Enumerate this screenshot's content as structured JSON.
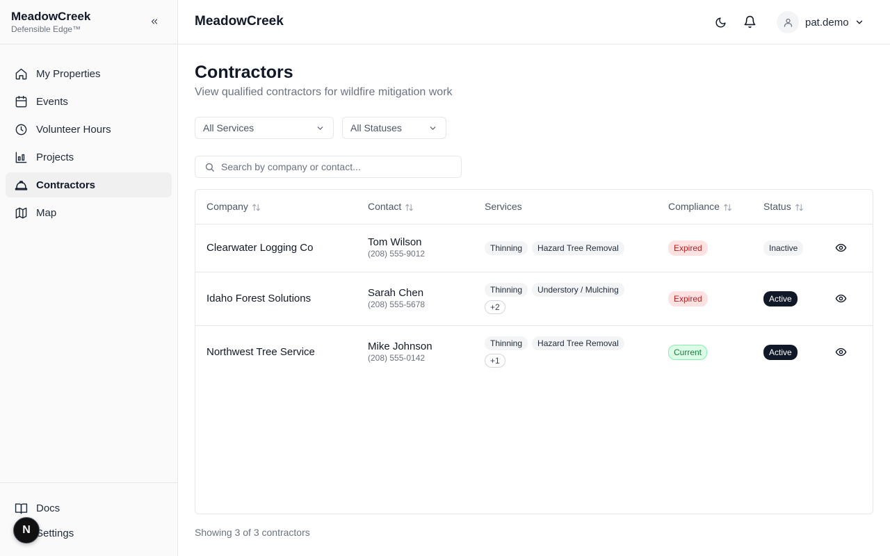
{
  "sidebar": {
    "brand": {
      "name": "MeadowCreek",
      "subtitle": "Defensible Edge™"
    },
    "items": [
      {
        "label": "My Properties",
        "icon": "home-icon"
      },
      {
        "label": "Events",
        "icon": "calendar-icon"
      },
      {
        "label": "Volunteer Hours",
        "icon": "clock-icon"
      },
      {
        "label": "Projects",
        "icon": "chart-icon"
      },
      {
        "label": "Contractors",
        "icon": "hard-hat-icon",
        "active": true
      },
      {
        "label": "Map",
        "icon": "map-icon"
      }
    ],
    "bottom_items": [
      {
        "label": "Docs",
        "icon": "book-icon"
      },
      {
        "label": "Settings",
        "icon": "gear-icon"
      }
    ],
    "floating_avatar": "N"
  },
  "header": {
    "title": "MeadowCreek",
    "user": {
      "name": "pat.demo"
    }
  },
  "page": {
    "title": "Contractors",
    "subtitle": "View qualified contractors for wildfire mitigation work"
  },
  "filters": {
    "services": {
      "selected": "All Services"
    },
    "statuses": {
      "selected": "All Statuses"
    }
  },
  "search": {
    "placeholder": "Search by company or contact...",
    "value": ""
  },
  "table": {
    "columns": [
      "Company",
      "Contact",
      "Services",
      "Compliance",
      "Status"
    ],
    "rows": [
      {
        "company": "Clearwater Logging Co",
        "contact_name": "Tom Wilson",
        "contact_phone": "(208) 555-9012",
        "services": [
          "Thinning",
          "Hazard Tree Removal"
        ],
        "more": "",
        "compliance": "Expired",
        "status": "Inactive"
      },
      {
        "company": "Idaho Forest Solutions",
        "contact_name": "Sarah Chen",
        "contact_phone": "(208) 555-5678",
        "services": [
          "Thinning",
          "Understory / Mulching"
        ],
        "more": "+2",
        "compliance": "Expired",
        "status": "Active"
      },
      {
        "company": "Northwest Tree Service",
        "contact_name": "Mike Johnson",
        "contact_phone": "(208) 555-0142",
        "services": [
          "Thinning",
          "Hazard Tree Removal"
        ],
        "more": "+1",
        "compliance": "Current",
        "status": "Active"
      }
    ]
  },
  "footer": {
    "count_text": "Showing 3 of 3 contractors"
  },
  "colors": {
    "expired_bg": "#fee2e2",
    "expired_text": "#b91c1c",
    "current_bg": "#dcfce7",
    "current_text": "#15803d",
    "active_bg": "#111827"
  }
}
